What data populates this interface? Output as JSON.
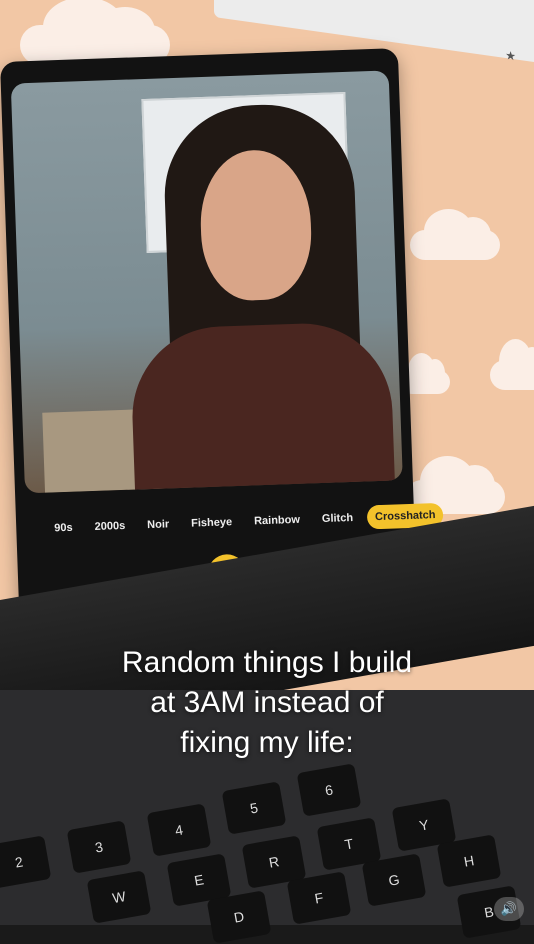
{
  "filters": [
    "90s",
    "2000s",
    "Noir",
    "Fisheye",
    "Rainbow",
    "Glitch",
    "Crosshatch"
  ],
  "active_filter": "Crosshatch",
  "shutter_icon": "camera-icon",
  "caption": {
    "line1": "Random things I build",
    "line2": "at 3AM instead of",
    "line3": "fixing my life:"
  },
  "keys": [
    "2",
    "3",
    "4",
    "5",
    "6",
    "W",
    "E",
    "R",
    "T",
    "Y",
    "D",
    "F",
    "G",
    "H",
    "B"
  ],
  "colors": {
    "accent": "#f3c22b",
    "wallpaper": "#f2c7a5",
    "clouds": "#fbeee6",
    "window": "#121212"
  }
}
